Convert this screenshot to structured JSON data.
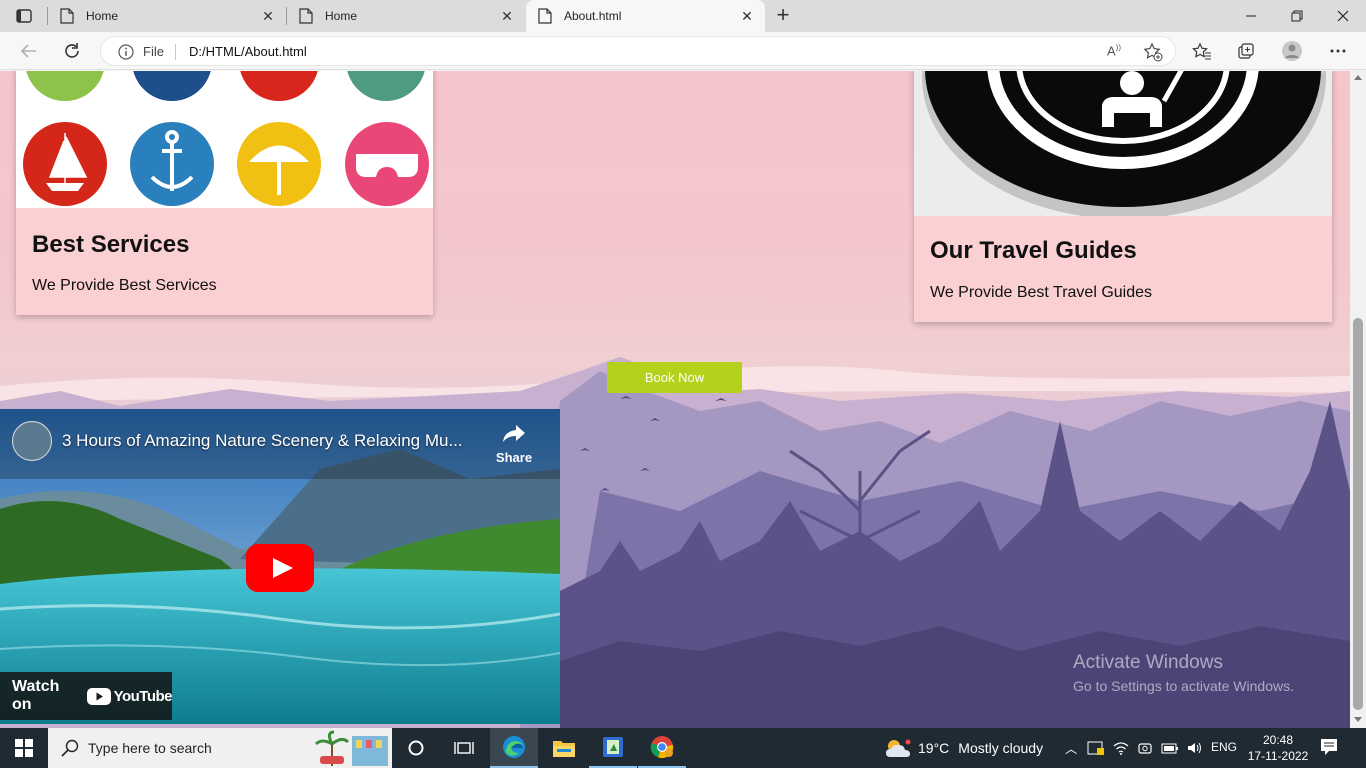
{
  "browser": {
    "tabs": [
      {
        "title": "Home",
        "active": false
      },
      {
        "title": "Home",
        "active": false
      },
      {
        "title": "About.html",
        "active": true
      }
    ],
    "address": {
      "scheme_label": "File",
      "url": "D:/HTML/About.html"
    }
  },
  "page": {
    "cards": {
      "services": {
        "title": "Best Services",
        "text": "We Provide Best Services"
      },
      "guides": {
        "title": "Our Travel Guides",
        "text": "We Provide Best Travel Guides"
      }
    },
    "book_now": "Book Now",
    "video": {
      "title": "3 Hours of Amazing Nature Scenery & Relaxing Mu...",
      "share_label": "Share",
      "watch_on": "Watch on",
      "youtube": "YouTube"
    },
    "watermark": {
      "line1": "Activate Windows",
      "line2": "Go to Settings to activate Windows."
    }
  },
  "taskbar": {
    "search_placeholder": "Type here to search",
    "weather": {
      "temp": "19°C",
      "condition": "Mostly cloudy"
    },
    "language": "ENG",
    "time": "20:48",
    "date": "17-11-2022"
  },
  "colors": {
    "book_now_bg": "#b5d11c",
    "card_bg": "#fad0d3",
    "taskbar_bg": "#1f2a33"
  }
}
